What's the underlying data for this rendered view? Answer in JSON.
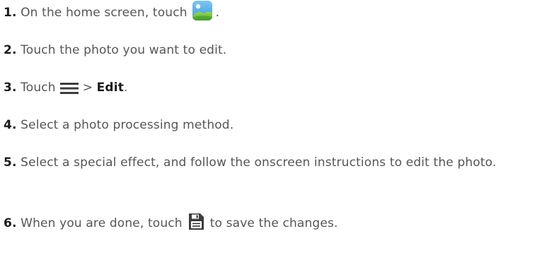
{
  "steps": [
    {
      "number": "1.",
      "text_before": "On the home screen, touch",
      "icon": "gallery-icon",
      "text_after": "."
    },
    {
      "number": "2.",
      "text": "Touch the photo you want to edit."
    },
    {
      "number": "3.",
      "text_before": "Touch",
      "icon": "menu-icon",
      "separator": ">",
      "bold_text": "Edit",
      "text_after": "."
    },
    {
      "number": "4.",
      "text": "Select a photo processing method."
    },
    {
      "number": "5.",
      "text": "Select a special effect, and follow the onscreen instructions to edit the photo."
    },
    {
      "number": "6.",
      "text_before": "When you are done, touch",
      "icon": "save-icon",
      "text_after": "to save the changes."
    }
  ],
  "colors": {
    "text": "#555555",
    "step_number": "#1a1a1a",
    "gallery_sky": "#4aa8e0",
    "gallery_hills": "#6cc24a",
    "icon_dark": "#3c3c3c"
  }
}
